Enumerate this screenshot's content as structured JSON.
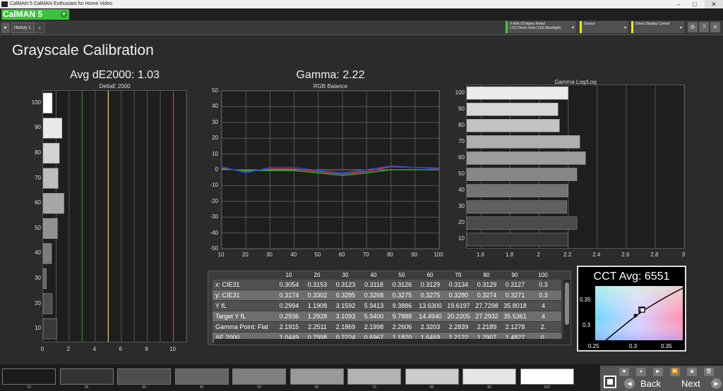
{
  "window": {
    "title": "CalMAN 5 CalMAN Enthusiast for Home Video",
    "min": "–",
    "max": "□",
    "close": "✕"
  },
  "app": {
    "logo": "CalMAN 5",
    "logo_arrow": "▾"
  },
  "tabs": {
    "nav": "▸",
    "active": "History 1",
    "add": "+"
  },
  "toolbar": {
    "meter_line1": "X-Rite i1Display Retail",
    "meter_line2": "LCD Direct View (LED Backlight)",
    "source": "Source",
    "display": "Direct Display Control",
    "caret": "▾",
    "icons": [
      "gear-icon",
      "help-icon",
      "close-icon"
    ],
    "icon_glyphs": [
      "⚙",
      "?",
      "✕"
    ],
    "colors": {
      "meter": "#3dd13d",
      "source": "#ffea00",
      "display": "#ffea00"
    }
  },
  "page": {
    "heading": "Grayscale Calibration"
  },
  "deltae": {
    "title": "Avg dE2000: 1.03",
    "subtitle": "DeltaE 2000",
    "ylabels": [
      "100",
      "90",
      "80",
      "70",
      "60",
      "50",
      "40",
      "30",
      "20",
      "10"
    ],
    "xlabels": [
      "0",
      "2",
      "4",
      "6",
      "8",
      "10"
    ],
    "thresholds": [
      {
        "value": 3,
        "color": "#2e8b2e"
      },
      {
        "value": 5,
        "color": "#e8d23a"
      },
      {
        "value": 10,
        "color": "#d43a3a"
      }
    ]
  },
  "rgb": {
    "title": "Gamma: 2.22",
    "subtitle": "RGB Balance",
    "ylabels": [
      "50",
      "40",
      "30",
      "20",
      "10",
      "0",
      "-10",
      "-20",
      "-30",
      "-40",
      "-50"
    ],
    "xlabels": [
      "10",
      "20",
      "30",
      "40",
      "50",
      "60",
      "70",
      "80",
      "90",
      "100"
    ]
  },
  "gamma": {
    "subtitle": "Gamma Log/Log",
    "ylabels": [
      "100",
      "90",
      "80",
      "70",
      "60",
      "50",
      "40",
      "30",
      "20",
      "10"
    ],
    "xlabels": [
      "1.6",
      "1.8",
      "2",
      "2.2",
      "2.4",
      "2.6",
      "2.8",
      "3"
    ]
  },
  "chart_data": [
    {
      "type": "bar",
      "title": "Avg dE2000: 1.03",
      "subtitle": "DeltaE 2000",
      "orientation": "horizontal",
      "categories": [
        "100",
        "90",
        "80",
        "70",
        "60",
        "50",
        "40",
        "30",
        "20",
        "10"
      ],
      "values": [
        0.7,
        1.45,
        1.25,
        1.15,
        1.6,
        1.1,
        0.65,
        0.25,
        0.7,
        1.05
      ],
      "xlim": [
        0,
        11
      ],
      "grid": true
    },
    {
      "type": "line",
      "title": "Gamma: 2.22",
      "subtitle": "RGB Balance",
      "x": [
        10,
        20,
        30,
        40,
        50,
        60,
        70,
        80,
        90,
        100
      ],
      "series": [
        {
          "color": "#d63a3a",
          "values": [
            1,
            -1,
            0.5,
            0.5,
            -1,
            -2.5,
            -1,
            2,
            1.5,
            1
          ]
        },
        {
          "color": "#2fa82f",
          "values": [
            0.5,
            -0.5,
            -0.5,
            -0.5,
            -2,
            -3.5,
            -2,
            0,
            0,
            0
          ]
        },
        {
          "color": "#2a3fd6",
          "values": [
            2,
            -2,
            1.5,
            1.5,
            -0.5,
            -2,
            0,
            2.5,
            1.5,
            0.5
          ]
        }
      ],
      "ylim": [
        -50,
        50
      ],
      "xlim": [
        10,
        100
      ],
      "grid": true
    },
    {
      "type": "bar",
      "subtitle": "Gamma Log/Log",
      "orientation": "horizontal",
      "categories": [
        "100",
        "90",
        "80",
        "70",
        "60",
        "50",
        "40",
        "30",
        "20",
        "10"
      ],
      "values": [
        2.2,
        2.13,
        2.14,
        2.28,
        2.32,
        2.26,
        2.2,
        2.19,
        2.26,
        2.2
      ],
      "xlim": [
        1.5,
        3
      ],
      "grid": true
    }
  ],
  "table": {
    "headers": [
      "10",
      "20",
      "30",
      "40",
      "50",
      "60",
      "70",
      "80",
      "90",
      "100"
    ],
    "rows": [
      {
        "label": "x: CIE31",
        "values": [
          "0.3054",
          "0.3153",
          "0.3123",
          "0.3118",
          "0.3126",
          "0.3129",
          "0.3134",
          "0.3129",
          "0.3127",
          "0.3"
        ]
      },
      {
        "label": "y: CIE31",
        "values": [
          "0.3174",
          "0.3302",
          "0.3285",
          "0.3268",
          "0.3275",
          "0.3275",
          "0.3280",
          "0.3274",
          "0.3271",
          "0.3"
        ]
      },
      {
        "label": "Y fL",
        "values": [
          "0.2994",
          "1.1908",
          "3.1592",
          "5.9413",
          "9.3886",
          "13.6300",
          "19.6197",
          "27.7298",
          "35.8018",
          "4"
        ]
      },
      {
        "label": "Target Y fL",
        "values": [
          "0.2936",
          "1.2928",
          "3.1093",
          "5.9400",
          "9.7888",
          "14.4940",
          "20.2205",
          "27.2932",
          "35.5361",
          "4"
        ]
      },
      {
        "label": "Gamma Point: Flat",
        "values": [
          "2.1915",
          "2.2511",
          "2.1869",
          "2.1998",
          "2.2606",
          "2.3203",
          "2.2839",
          "2.2189",
          "2.1278",
          "2."
        ]
      },
      {
        "label": "ΔE 2000",
        "values": [
          "1.0449",
          "0.7998",
          "0.2224",
          "0.6967",
          "1.1820",
          "1.6469",
          "1.2122",
          "1.2907",
          "1.4827",
          "0."
        ]
      }
    ],
    "row_colors": [
      "#505050",
      "#6e6e6e"
    ]
  },
  "cct": {
    "title": "CCT Avg: 6551",
    "ylabels": [
      "0.35",
      "0.3"
    ],
    "xlabels": [
      "0.25",
      "0.3",
      "0.35"
    ]
  },
  "swatches": {
    "labels": [
      "10",
      "20",
      "30",
      "40",
      "50",
      "60",
      "70",
      "80",
      "90",
      "100"
    ],
    "colors": [
      "#1a1a1a",
      "#333333",
      "#4d4d4d",
      "#666666",
      "#808080",
      "#999999",
      "#b3b3b3",
      "#cccccc",
      "#e6e6e6",
      "#ffffff"
    ]
  },
  "controls": {
    "icons": [
      "stop-icon",
      "record-icon",
      "play-icon",
      "fast-forward-icon",
      "settings-icon",
      "delete-icon"
    ],
    "icon_glyphs": [
      "■",
      "●",
      "▶",
      "⏩",
      "◉",
      "🗑"
    ],
    "back": "Back",
    "next": "Next",
    "back_glyph": "◀",
    "next_glyph": "▶"
  }
}
